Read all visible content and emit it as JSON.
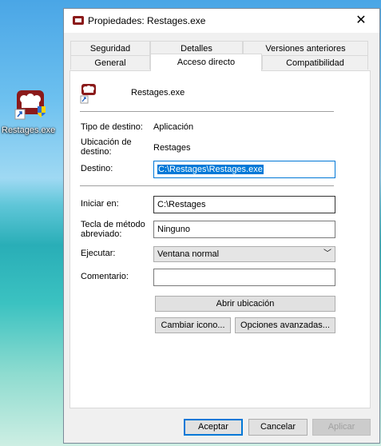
{
  "desktop": {
    "icon_label": "Restages.exe"
  },
  "window": {
    "title": "Propiedades: Restages.exe",
    "close_glyph": "✕"
  },
  "tabs": {
    "row1": [
      "Seguridad",
      "Detalles",
      "Versiones anteriores"
    ],
    "row2": [
      "General",
      "Acceso directo",
      "Compatibilidad"
    ],
    "active": "Acceso directo"
  },
  "header": {
    "name": "Restages.exe"
  },
  "info": {
    "target_type_label": "Tipo de destino:",
    "target_type_value": "Aplicación",
    "target_location_label": "Ubicación de\ndestino:",
    "target_location_value": "Restages",
    "target_label": "Destino:",
    "target_value": "C:\\Restages\\Restages.exe"
  },
  "form": {
    "start_in_label": "Iniciar en:",
    "start_in_value": "C:\\Restages",
    "hotkey_label": "Tecla de método\nabreviado:",
    "hotkey_value": "Ninguno",
    "run_label": "Ejecutar:",
    "run_value": "Ventana normal",
    "comment_label": "Comentario:",
    "comment_value": ""
  },
  "buttons": {
    "open_location": "Abrir ubicación",
    "change_icon": "Cambiar icono...",
    "advanced": "Opciones avanzadas...",
    "ok": "Aceptar",
    "cancel": "Cancelar",
    "apply": "Aplicar"
  },
  "colors": {
    "accent": "#0078d7",
    "brand_red": "#8b1a1a"
  }
}
